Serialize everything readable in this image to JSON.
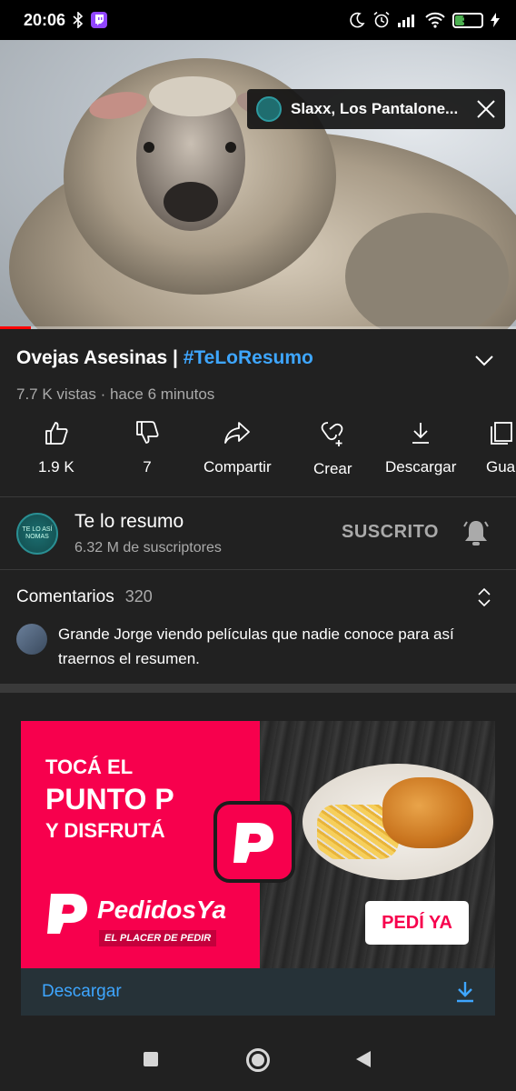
{
  "status_bar": {
    "time": "20:06",
    "battery": "34",
    "icons": [
      "bluetooth-icon",
      "twitch-icon",
      "moon-icon",
      "alarm-icon",
      "signal-icon",
      "wifi-icon",
      "battery-icon",
      "charging-icon"
    ]
  },
  "player": {
    "mini_banner_text": "Slaxx, Los Pantalone...",
    "progress_fraction": 0.06
  },
  "video": {
    "title_main": "Ovejas Asesinas | ",
    "title_hashtag": "#TeLoResumo",
    "meta": "7.7 K vistas · hace 6 minutos"
  },
  "actions": [
    {
      "label": "1.9 K",
      "icon": "thumbs-up-icon"
    },
    {
      "label": "7",
      "icon": "thumbs-down-icon"
    },
    {
      "label": "Compartir",
      "icon": "share-icon"
    },
    {
      "label": "Crear",
      "icon": "create-icon"
    },
    {
      "label": "Descargar",
      "icon": "download-icon"
    },
    {
      "label": "Gua",
      "icon": "save-icon"
    }
  ],
  "channel": {
    "avatar_text": "TE LO ASÍ NOMAS",
    "name": "Te lo resumo",
    "subscribers": "6.32 M de suscriptores",
    "subscribe_state": "SUSCRITO"
  },
  "comments": {
    "label": "Comentarios",
    "count": "320",
    "top_comment": "Grande Jorge viendo películas que nadie conoce para así traernos el resumen."
  },
  "ad": {
    "line1": "TOCÁ EL",
    "line2": "PUNTO P",
    "line3": "Y DISFRUTÁ",
    "brand": "PedidosYa",
    "tagline": "EL PLACER DE PEDIR",
    "cta": "PEDÍ YA",
    "bar_label": "Descargar",
    "colors": {
      "brand": "#f7004d",
      "link": "#3ea6ff"
    }
  }
}
